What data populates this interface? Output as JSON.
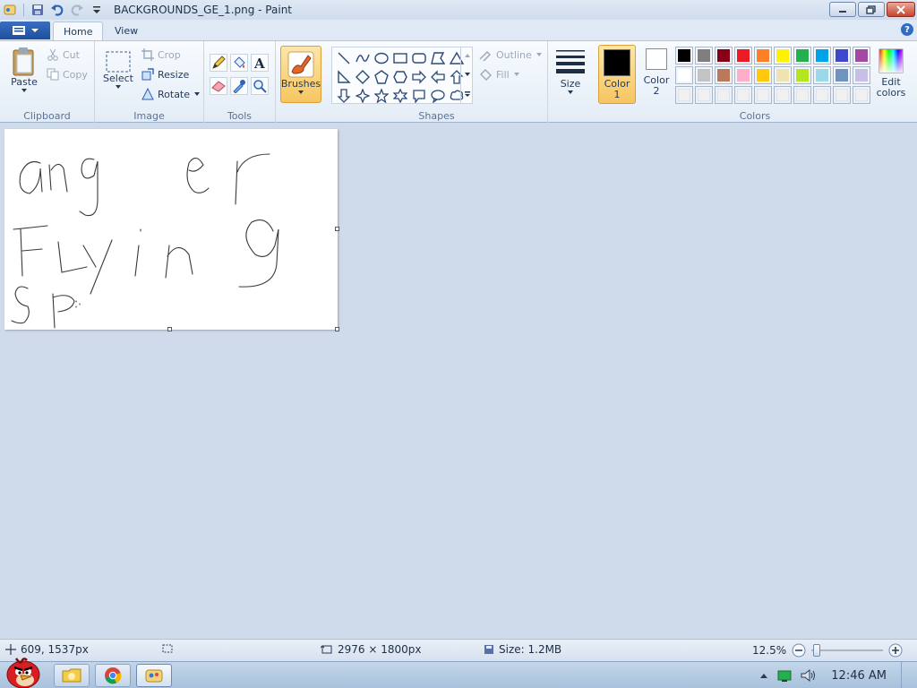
{
  "window": {
    "title": "BACKGROUNDS_GE_1.png - Paint"
  },
  "tabs": [
    {
      "label": "Home",
      "active": true
    },
    {
      "label": "View",
      "active": false
    }
  ],
  "ribbon": {
    "clipboard": {
      "group_label": "Clipboard",
      "paste_label": "Paste",
      "cut_label": "Cut",
      "copy_label": "Copy"
    },
    "image": {
      "group_label": "Image",
      "select_label": "Select",
      "crop_label": "Crop",
      "resize_label": "Resize",
      "rotate_label": "Rotate"
    },
    "tools": {
      "group_label": "Tools",
      "items": [
        "pencil-icon",
        "fill-bucket-icon",
        "text-icon",
        "eraser-icon",
        "color-picker-icon",
        "magnifier-icon"
      ]
    },
    "brushes": {
      "label": "Brushes"
    },
    "shapes": {
      "group_label": "Shapes",
      "outline_label": "Outline",
      "fill_label": "Fill"
    },
    "size": {
      "label": "Size"
    },
    "colors": {
      "group_label": "Colors",
      "color1_label": "Color",
      "color1_sub": "1",
      "color2_label": "Color",
      "color2_sub": "2",
      "color1_value": "#000000",
      "color2_value": "#ffffff",
      "edit_label": "Edit",
      "edit_sub": "colors",
      "palette_row1": [
        "#000000",
        "#7f7f7f",
        "#880015",
        "#ed1c24",
        "#ff7f27",
        "#fff200",
        "#22b14c",
        "#00a2e8",
        "#3f48cc",
        "#a349a4"
      ],
      "palette_row2": [
        "#ffffff",
        "#c3c3c3",
        "#b97a57",
        "#ffaec9",
        "#ffc90e",
        "#efe4b0",
        "#b5e61d",
        "#99d9ea",
        "#7092be",
        "#c8bfe7"
      ],
      "palette_row3": [
        "#f0f0f0",
        "#f0f0f0",
        "#f0f0f0",
        "#f0f0f0",
        "#f0f0f0",
        "#f0f0f0",
        "#f0f0f0",
        "#f0f0f0",
        "#f0f0f0",
        "#f0f0f0"
      ]
    }
  },
  "status": {
    "cursor_position": "609, 1537px",
    "image_size": "2976 × 1800px",
    "file_size": "Size: 1.2MB",
    "zoom": "12.5%"
  },
  "taskbar": {
    "clock": "12:46 AM"
  }
}
